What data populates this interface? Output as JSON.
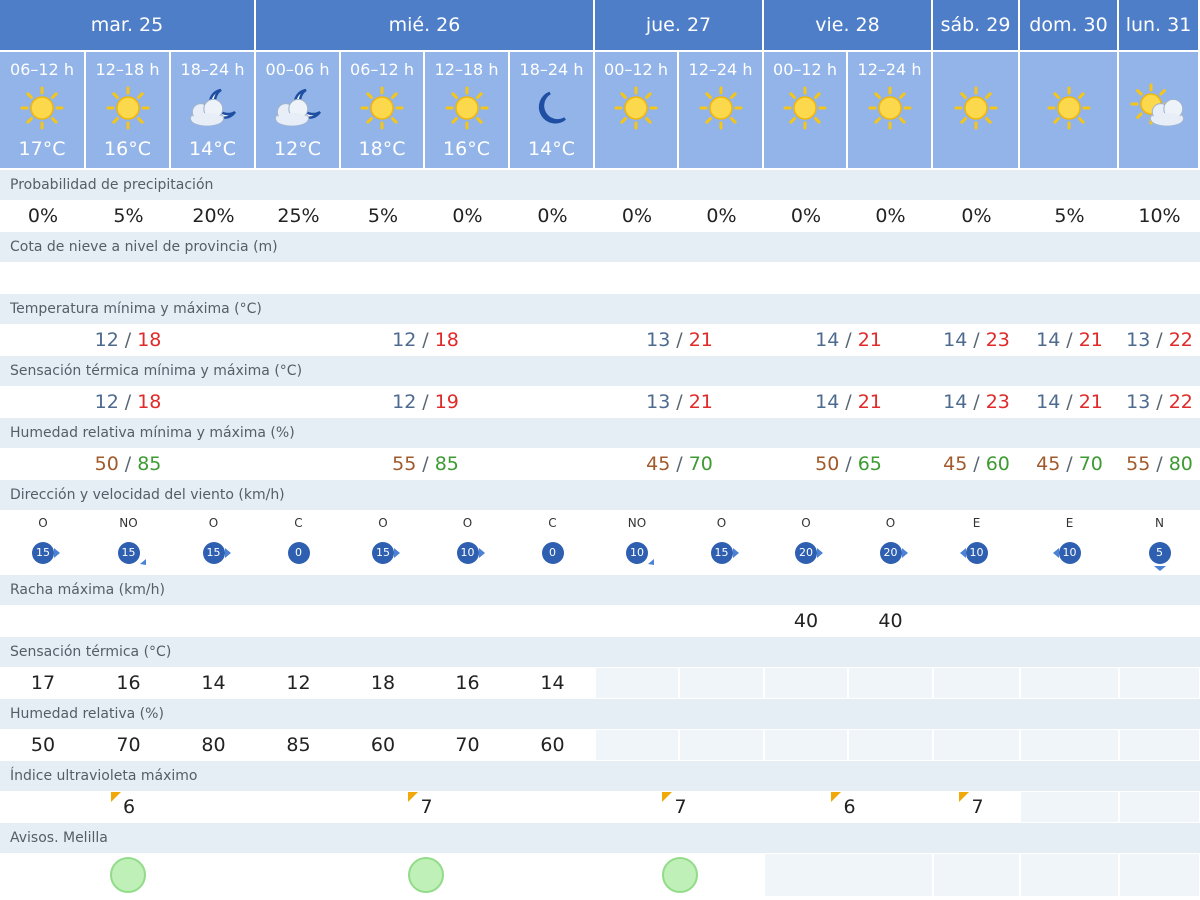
{
  "colors": {
    "header": "#4f7ec8",
    "period": "#93b4e8",
    "label_bar": "#e6eef5",
    "empty": "#f0f5fa",
    "temp_min": "#4d6a8f",
    "temp_max": "#e02a2a",
    "hum_min": "#a05a2c",
    "hum_max": "#3e9b33",
    "wind_badge": "#2f5fb0",
    "sun": "#f5c518",
    "warning_green": "#bff0b8"
  },
  "days": [
    {
      "label": "mar. 25",
      "span": 3
    },
    {
      "label": "mié. 26",
      "span": 4
    },
    {
      "label": "jue. 27",
      "span": 2
    },
    {
      "label": "vie. 28",
      "span": 2
    },
    {
      "label": "sáb. 29",
      "span": 1
    },
    {
      "label": "dom. 30",
      "span": 1
    },
    {
      "label": "lun. 31",
      "span": 1
    }
  ],
  "periods": [
    {
      "label": "06–12 h",
      "icon": "sun-icon",
      "temp": "17°C"
    },
    {
      "label": "12–18 h",
      "icon": "sun-icon",
      "temp": "16°C"
    },
    {
      "label": "18–24 h",
      "icon": "moon-cloud-icon",
      "temp": "14°C"
    },
    {
      "label": "00–06 h",
      "icon": "moon-cloud-icon",
      "temp": "12°C"
    },
    {
      "label": "06–12 h",
      "icon": "sun-icon",
      "temp": "18°C"
    },
    {
      "label": "12–18 h",
      "icon": "sun-icon",
      "temp": "16°C"
    },
    {
      "label": "18–24 h",
      "icon": "moon-icon",
      "temp": "14°C"
    },
    {
      "label": "00–12 h",
      "icon": "sun-icon",
      "temp": ""
    },
    {
      "label": "12–24 h",
      "icon": "sun-icon",
      "temp": ""
    },
    {
      "label": "00–12 h",
      "icon": "sun-icon",
      "temp": ""
    },
    {
      "label": "12–24 h",
      "icon": "sun-icon",
      "temp": ""
    },
    {
      "label": "",
      "icon": "sun-icon",
      "temp": ""
    },
    {
      "label": "",
      "icon": "sun-icon",
      "temp": ""
    },
    {
      "label": "",
      "icon": "sun-cloud-icon",
      "temp": ""
    }
  ],
  "rows": [
    {
      "key": "precip",
      "label": "Probabilidad de precipitación",
      "type": "periods",
      "values": [
        "0%",
        "5%",
        "20%",
        "25%",
        "5%",
        "0%",
        "0%",
        "0%",
        "0%",
        "0%",
        "0%",
        "0%",
        "5%",
        "10%"
      ]
    },
    {
      "key": "snow",
      "label": "Cota de nieve a nivel de provincia (m)",
      "type": "periods",
      "values": [
        "",
        "",
        "",
        "",
        "",
        "",
        "",
        "",
        "",
        "",
        "",
        "",
        "",
        ""
      ]
    },
    {
      "key": "temp",
      "label": "Temperatura mínima y máxima (°C)",
      "type": "minmax",
      "style": "temp",
      "values": [
        {
          "min": "12",
          "max": "18"
        },
        {
          "min": "12",
          "max": "18"
        },
        {
          "min": "13",
          "max": "21"
        },
        {
          "min": "14",
          "max": "21"
        },
        {
          "min": "14",
          "max": "23"
        },
        {
          "min": "14",
          "max": "21"
        },
        {
          "min": "13",
          "max": "22"
        }
      ]
    },
    {
      "key": "feels",
      "label": "Sensación térmica mínima y máxima (°C)",
      "type": "minmax",
      "style": "temp",
      "values": [
        {
          "min": "12",
          "max": "18"
        },
        {
          "min": "12",
          "max": "19"
        },
        {
          "min": "13",
          "max": "21"
        },
        {
          "min": "14",
          "max": "21"
        },
        {
          "min": "14",
          "max": "23"
        },
        {
          "min": "14",
          "max": "21"
        },
        {
          "min": "13",
          "max": "22"
        }
      ]
    },
    {
      "key": "humidity",
      "label": "Humedad relativa mínima y máxima (%)",
      "type": "minmax",
      "style": "hum",
      "values": [
        {
          "min": "50",
          "max": "85"
        },
        {
          "min": "55",
          "max": "85"
        },
        {
          "min": "45",
          "max": "70"
        },
        {
          "min": "50",
          "max": "65"
        },
        {
          "min": "45",
          "max": "60"
        },
        {
          "min": "45",
          "max": "70"
        },
        {
          "min": "55",
          "max": "80"
        }
      ]
    },
    {
      "key": "wind",
      "label": "Dirección y velocidad del viento (km/h)",
      "type": "wind",
      "values": [
        {
          "dir": "O",
          "speed": "15"
        },
        {
          "dir": "NO",
          "speed": "15"
        },
        {
          "dir": "O",
          "speed": "15"
        },
        {
          "dir": "C",
          "speed": "0"
        },
        {
          "dir": "O",
          "speed": "15"
        },
        {
          "dir": "O",
          "speed": "10"
        },
        {
          "dir": "C",
          "speed": "0"
        },
        {
          "dir": "NO",
          "speed": "10"
        },
        {
          "dir": "O",
          "speed": "15"
        },
        {
          "dir": "O",
          "speed": "20"
        },
        {
          "dir": "O",
          "speed": "20"
        },
        {
          "dir": "E",
          "speed": "10"
        },
        {
          "dir": "E",
          "speed": "10"
        },
        {
          "dir": "N",
          "speed": "5"
        }
      ]
    },
    {
      "key": "gust",
      "label": "Racha máxima (km/h)",
      "type": "periods",
      "values": [
        "",
        "",
        "",
        "",
        "",
        "",
        "",
        "",
        "",
        "40",
        "40",
        "",
        "",
        ""
      ]
    },
    {
      "key": "feels_hourly",
      "label": "Sensación térmica (°C)",
      "type": "periods",
      "values": [
        "17",
        "16",
        "14",
        "12",
        "18",
        "16",
        "14",
        null,
        null,
        null,
        null,
        null,
        null,
        null
      ]
    },
    {
      "key": "hum_hourly",
      "label": "Humedad relativa (%)",
      "type": "periods",
      "values": [
        "50",
        "70",
        "80",
        "85",
        "60",
        "70",
        "60",
        null,
        null,
        null,
        null,
        null,
        null,
        null
      ]
    },
    {
      "key": "uv",
      "label": "Índice ultravioleta máximo",
      "type": "days",
      "values": [
        "6",
        "7",
        "7",
        "6",
        "7",
        null,
        null
      ]
    },
    {
      "key": "warnings",
      "label": "Avisos. Melilla",
      "type": "days",
      "values": [
        "green-circle",
        "green-circle",
        "green-circle",
        null,
        null,
        null,
        null
      ]
    }
  ]
}
